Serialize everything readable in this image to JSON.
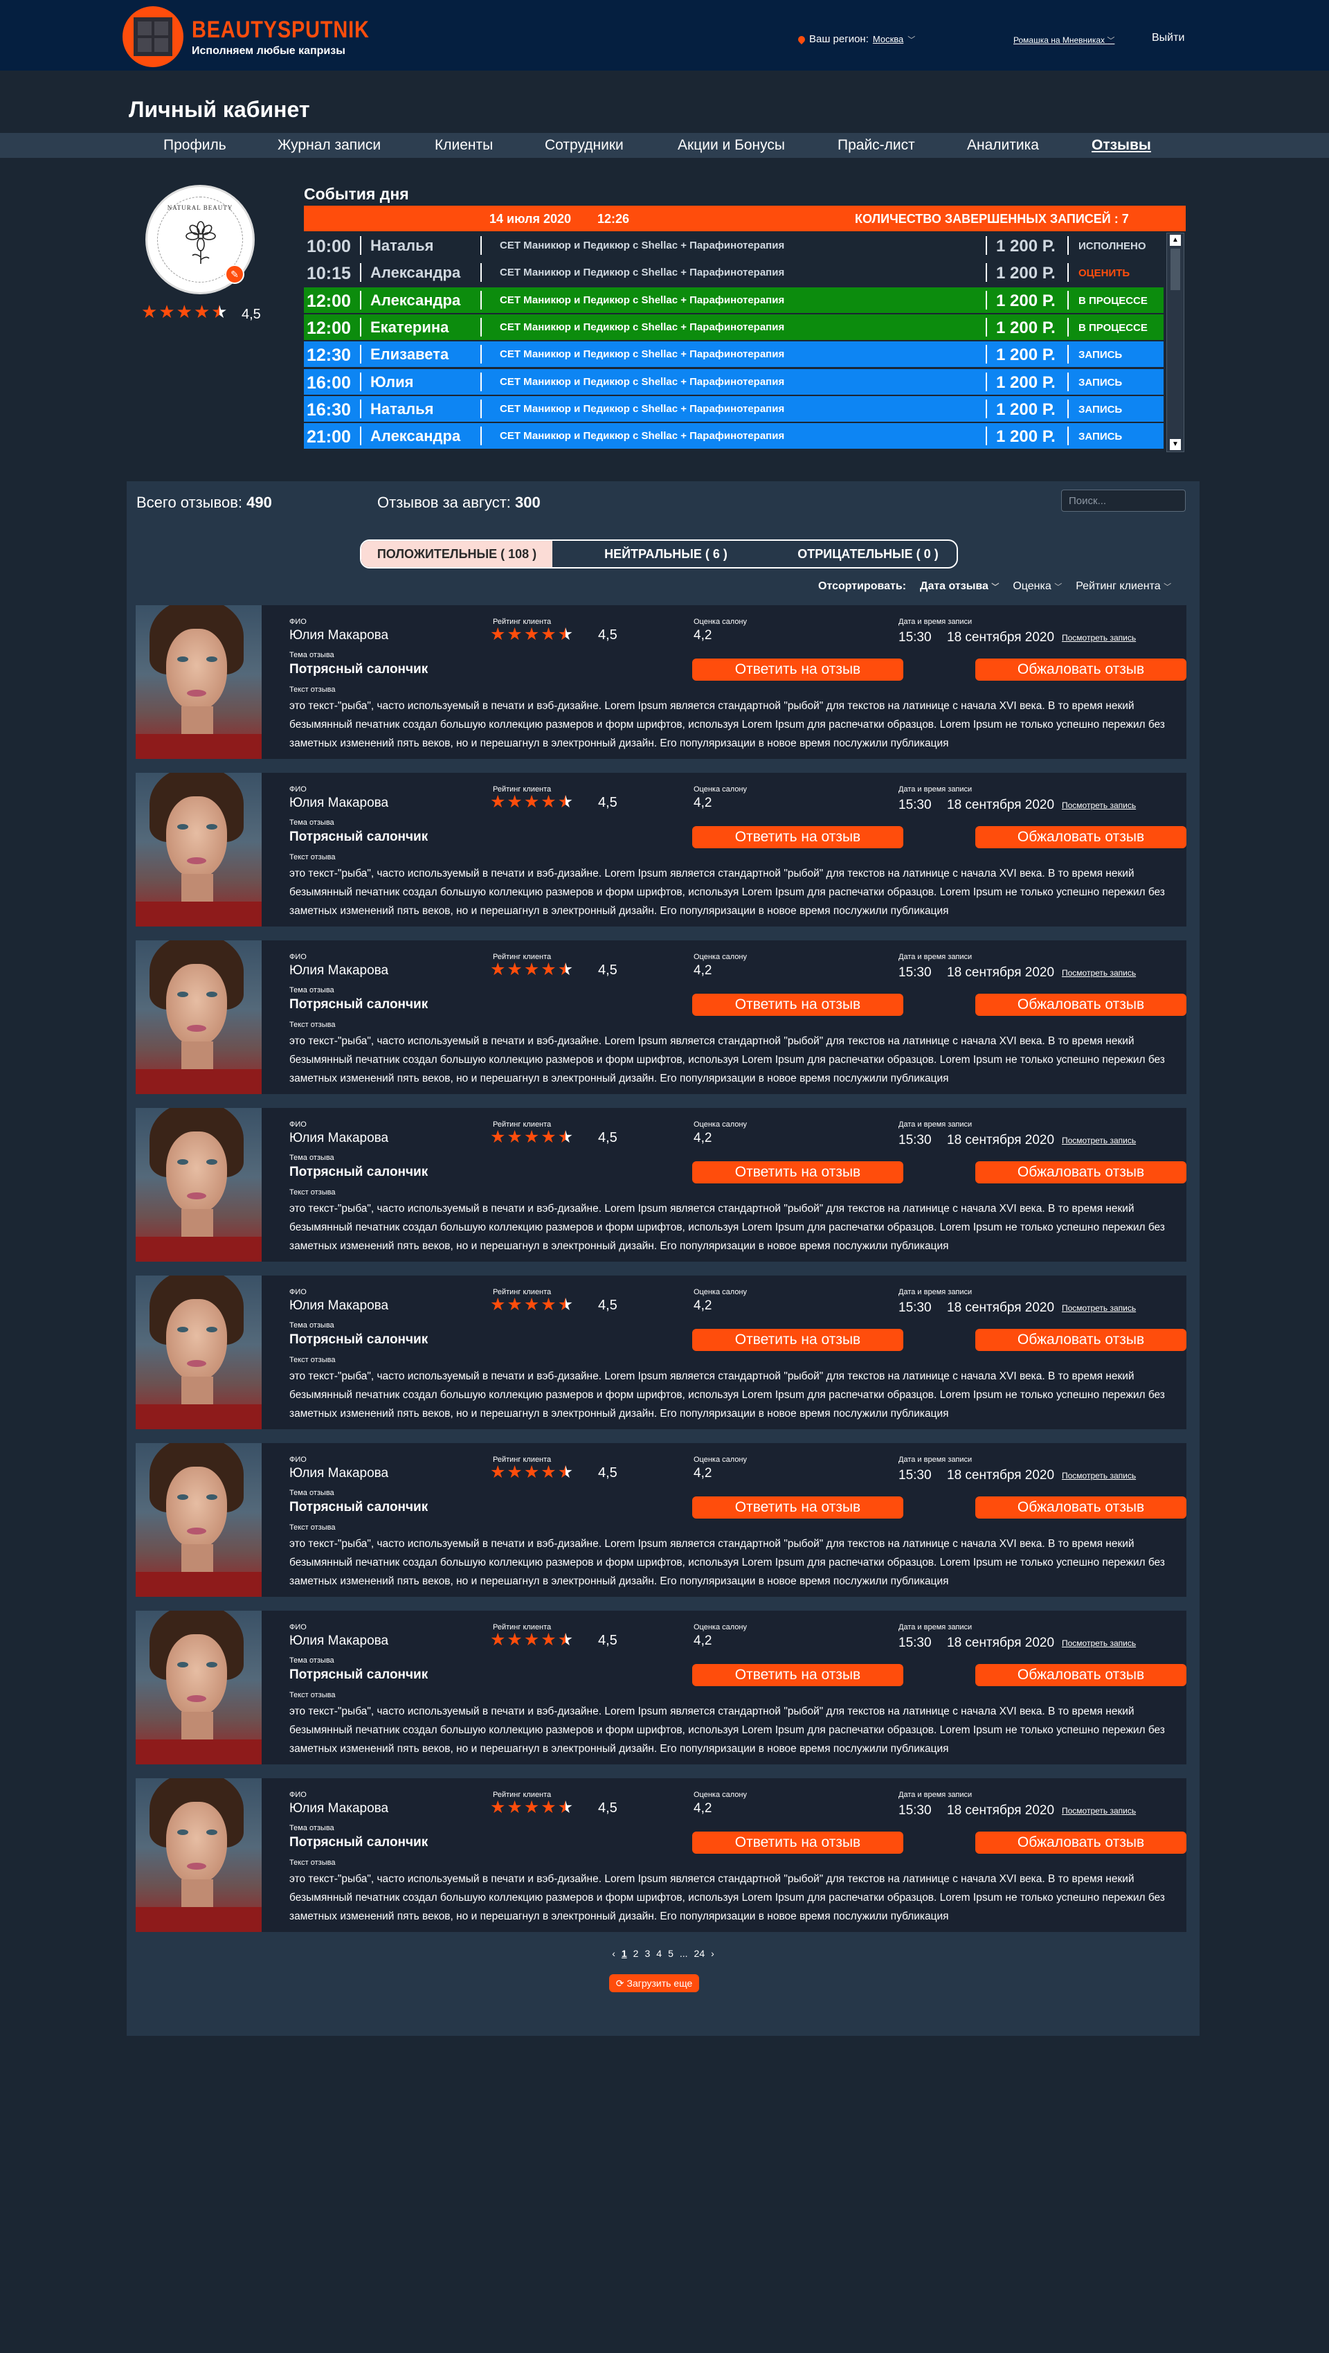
{
  "header": {
    "brand": "BEAUTYSPUTNIK",
    "slogan": "Исполняем любые капризы",
    "region_label": "Ваш регион:",
    "region_value": "Москва",
    "salon": "Ромашка на Мневниках",
    "logout": "Выйти"
  },
  "page_title": "Личный кабинет",
  "nav": [
    {
      "label": "Профиль"
    },
    {
      "label": "Журнал записи"
    },
    {
      "label": "Клиенты"
    },
    {
      "label": "Сотрудники"
    },
    {
      "label": "Акции и Бонусы"
    },
    {
      "label": "Прайс-лист"
    },
    {
      "label": "Аналитика"
    },
    {
      "label": "Отзывы",
      "active": true
    }
  ],
  "profile": {
    "avatar_text": "NATURAL BEAUTY",
    "rating": "4,5",
    "rating_value": 4.5
  },
  "events": {
    "title": "События дня",
    "date": "14 июля 2020",
    "time": "12:26",
    "completed": "КОЛИЧЕСТВО ЗАВЕРШЕННЫХ ЗАПИСЕЙ : 7",
    "rows": [
      {
        "time": "10:00",
        "name": "Наталья",
        "service": "СЕТ Маникюр и Педикюр с Shellac + Парафинотерапия",
        "price": "1 200 Р.",
        "status": "ИСПОЛНЕНО",
        "kind": "plain"
      },
      {
        "time": "10:15",
        "name": "Александра",
        "service": "СЕТ Маникюр и Педикюр с Shellac + Парафинотерапия",
        "price": "1 200 Р.",
        "status": "ОЦЕНИТЬ",
        "kind": "plain-rate"
      },
      {
        "time": "12:00",
        "name": "Александра",
        "service": "СЕТ Маникюр и Педикюр с Shellac + Парафинотерапия",
        "price": "1 200 Р.",
        "status": "В ПРОЦЕССЕ",
        "kind": "green"
      },
      {
        "time": "12:00",
        "name": "Екатерина",
        "service": "СЕТ Маникюр и Педикюр с Shellac + Парафинотерапия",
        "price": "1 200 Р.",
        "status": "В ПРОЦЕССЕ",
        "kind": "green"
      },
      {
        "time": "12:30",
        "name": "Елизавета",
        "service": "СЕТ Маникюр и Педикюр с Shellac + Парафинотерапия",
        "price": "1 200 Р.",
        "status": "ЗАПИСЬ",
        "kind": "blue"
      },
      {
        "time": "16:00",
        "name": "Юлия",
        "service": "СЕТ Маникюр и Педикюр с Shellac + Парафинотерапия",
        "price": "1 200 Р.",
        "status": "ЗАПИСЬ",
        "kind": "blue"
      },
      {
        "time": "16:30",
        "name": "Наталья",
        "service": "СЕТ Маникюр и Педикюр с Shellac + Парафинотерапия",
        "price": "1 200 Р.",
        "status": "ЗАПИСЬ",
        "kind": "blue"
      },
      {
        "time": "21:00",
        "name": "Александра",
        "service": "СЕТ Маникюр и Педикюр с Shellac + Парафинотерапия",
        "price": "1 200 Р.",
        "status": "ЗАПИСЬ",
        "kind": "blue"
      }
    ]
  },
  "reviews": {
    "total_label": "Всего отзывов:",
    "total_value": "490",
    "month_label": "Отзывов за август:",
    "month_value": "300",
    "search_placeholder": "Поиск...",
    "tabs": [
      {
        "label": "ПОЛОЖИТЕЛЬНЫЕ ( 108 )",
        "active": true
      },
      {
        "label": "НЕЙТРАЛЬНЫЕ ( 6 )"
      },
      {
        "label": "ОТРИЦАТЕЛЬНЫЕ ( 0 )"
      }
    ],
    "sort_label": "Отсортировать:",
    "sort_options": [
      {
        "label": "Дата отзыва",
        "active": true
      },
      {
        "label": "Оценка"
      },
      {
        "label": "Рейтинг клиента"
      }
    ],
    "labels": {
      "fio": "ФИО",
      "client_rating": "Рейтинг клиента",
      "salon_score": "Оценка салону",
      "datetime": "Дата и время записи",
      "topic": "Тема отзыва",
      "text": "Текст отзыва",
      "view_record": "Посмотреть запись",
      "reply": "Ответить на отзыв",
      "appeal": "Обжаловать отзыв"
    },
    "items": [
      {
        "name": "Юлия Макарова",
        "rating": "4,5",
        "rating_value": 4.5,
        "score": "4,2",
        "time": "15:30",
        "date": "18 сентября 2020",
        "topic": "Потрясный салончик",
        "text": "это текст-\"рыба\", часто используемый в печати и вэб-дизайне. Lorem Ipsum является стандартной \"рыбой\" для текстов на латинице с начала XVI века. В то время некий безымянный печатник создал большую коллекцию размеров и форм шрифтов, используя Lorem Ipsum для распечатки образцов. Lorem Ipsum не только успешно пережил без заметных изменений пять веков, но и перешагнул в электронный дизайн. Его популяризации в новое время послужили публикация"
      },
      {
        "name": "Юлия Макарова",
        "rating": "4,5",
        "rating_value": 4.5,
        "score": "4,2",
        "time": "15:30",
        "date": "18 сентября 2020",
        "topic": "Потрясный салончик",
        "text": "это текст-\"рыба\", часто используемый в печати и вэб-дизайне. Lorem Ipsum является стандартной \"рыбой\" для текстов на латинице с начала XVI века. В то время некий безымянный печатник создал большую коллекцию размеров и форм шрифтов, используя Lorem Ipsum для распечатки образцов. Lorem Ipsum не только успешно пережил без заметных изменений пять веков, но и перешагнул в электронный дизайн. Его популяризации в новое время послужили публикация"
      },
      {
        "name": "Юлия Макарова",
        "rating": "4,5",
        "rating_value": 4.5,
        "score": "4,2",
        "time": "15:30",
        "date": "18 сентября 2020",
        "topic": "Потрясный салончик",
        "text": "это текст-\"рыба\", часто используемый в печати и вэб-дизайне. Lorem Ipsum является стандартной \"рыбой\" для текстов на латинице с начала XVI века. В то время некий безымянный печатник создал большую коллекцию размеров и форм шрифтов, используя Lorem Ipsum для распечатки образцов. Lorem Ipsum не только успешно пережил без заметных изменений пять веков, но и перешагнул в электронный дизайн. Его популяризации в новое время послужили публикация"
      },
      {
        "name": "Юлия Макарова",
        "rating": "4,5",
        "rating_value": 4.5,
        "score": "4,2",
        "time": "15:30",
        "date": "18 сентября 2020",
        "topic": "Потрясный салончик",
        "text": "это текст-\"рыба\", часто используемый в печати и вэб-дизайне. Lorem Ipsum является стандартной \"рыбой\" для текстов на латинице с начала XVI века. В то время некий безымянный печатник создал большую коллекцию размеров и форм шрифтов, используя Lorem Ipsum для распечатки образцов. Lorem Ipsum не только успешно пережил без заметных изменений пять веков, но и перешагнул в электронный дизайн. Его популяризации в новое время послужили публикация"
      },
      {
        "name": "Юлия Макарова",
        "rating": "4,5",
        "rating_value": 4.5,
        "score": "4,2",
        "time": "15:30",
        "date": "18 сентября 2020",
        "topic": "Потрясный салончик",
        "text": "это текст-\"рыба\", часто используемый в печати и вэб-дизайне. Lorem Ipsum является стандартной \"рыбой\" для текстов на латинице с начала XVI века. В то время некий безымянный печатник создал большую коллекцию размеров и форм шрифтов, используя Lorem Ipsum для распечатки образцов. Lorem Ipsum не только успешно пережил без заметных изменений пять веков, но и перешагнул в электронный дизайн. Его популяризации в новое время послужили публикация"
      },
      {
        "name": "Юлия Макарова",
        "rating": "4,5",
        "rating_value": 4.5,
        "score": "4,2",
        "time": "15:30",
        "date": "18 сентября 2020",
        "topic": "Потрясный салончик",
        "text": "это текст-\"рыба\", часто используемый в печати и вэб-дизайне. Lorem Ipsum является стандартной \"рыбой\" для текстов на латинице с начала XVI века. В то время некий безымянный печатник создал большую коллекцию размеров и форм шрифтов, используя Lorem Ipsum для распечатки образцов. Lorem Ipsum не только успешно пережил без заметных изменений пять веков, но и перешагнул в электронный дизайн. Его популяризации в новое время послужили публикация"
      },
      {
        "name": "Юлия Макарова",
        "rating": "4,5",
        "rating_value": 4.5,
        "score": "4,2",
        "time": "15:30",
        "date": "18 сентября 2020",
        "topic": "Потрясный салончик",
        "text": "это текст-\"рыба\", часто используемый в печати и вэб-дизайне. Lorem Ipsum является стандартной \"рыбой\" для текстов на латинице с начала XVI века. В то время некий безымянный печатник создал большую коллекцию размеров и форм шрифтов, используя Lorem Ipsum для распечатки образцов. Lorem Ipsum не только успешно пережил без заметных изменений пять веков, но и перешагнул в электронный дизайн. Его популяризации в новое время послужили публикация"
      },
      {
        "name": "Юлия Макарова",
        "rating": "4,5",
        "rating_value": 4.5,
        "score": "4,2",
        "time": "15:30",
        "date": "18 сентября 2020",
        "topic": "Потрясный салончик",
        "text": "это текст-\"рыба\", часто используемый в печати и вэб-дизайне. Lorem Ipsum является стандартной \"рыбой\" для текстов на латинице с начала XVI века. В то время некий безымянный печатник создал большую коллекцию размеров и форм шрифтов, используя Lorem Ipsum для распечатки образцов. Lorem Ipsum не только успешно пережил без заметных изменений пять веков, но и перешагнул в электронный дизайн. Его популяризации в новое время послужили публикация"
      }
    ],
    "pagination": {
      "prev": "‹",
      "pages": [
        "1",
        "2",
        "3",
        "4",
        "5",
        "...",
        "24"
      ],
      "current": "1",
      "next": "›"
    },
    "load_more": "Загрузить еще"
  },
  "colors": {
    "accent": "#ff4d0c",
    "header_bg": "#051f40",
    "page_bg": "#1b2633",
    "panel_bg": "#263749",
    "in_progress": "#0c8c0d",
    "booked": "#0d85f3"
  }
}
